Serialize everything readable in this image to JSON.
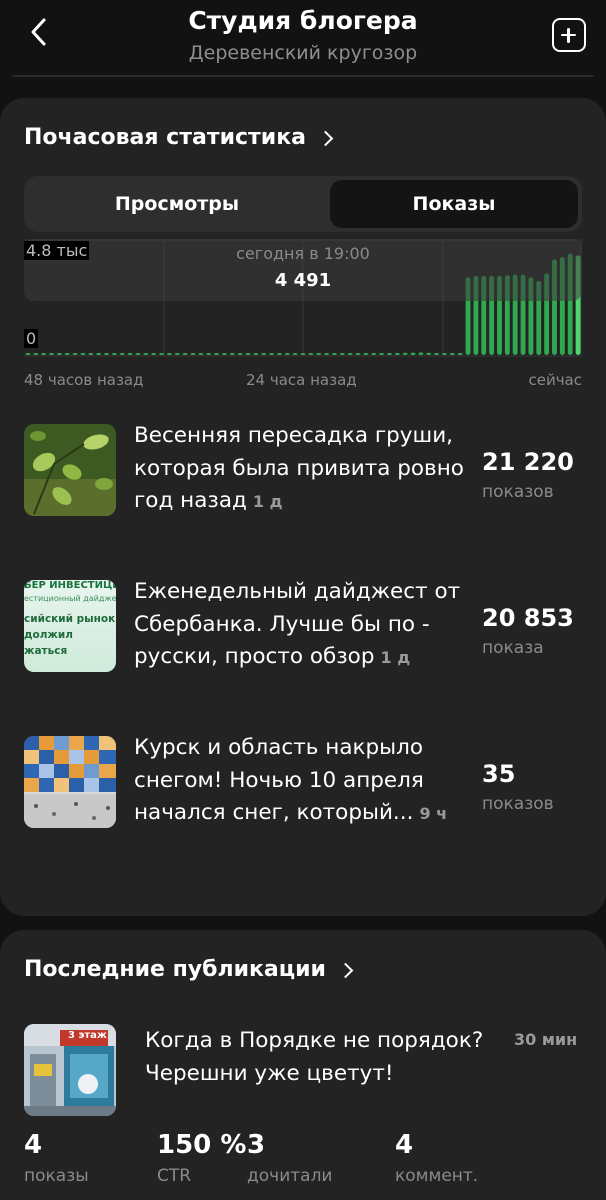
{
  "header": {
    "title": "Студия блогера",
    "subtitle": "Деревенский кругозор"
  },
  "hourly": {
    "title": "Почасовая статистика",
    "tabs": [
      "Просмотры",
      "Показы"
    ],
    "selected_tab": "Показы",
    "tooltip_label": "сегодня в 19:00",
    "tooltip_value": "4 491",
    "y_max_label": "4.8 тыс",
    "y_min_label": "0",
    "x_labels": [
      "48 часов назад",
      "24 часа назад",
      "сейчас"
    ]
  },
  "chart_data": {
    "type": "bar",
    "title": "",
    "xlabel": "",
    "ylabel": "",
    "ylim": [
      0,
      4800
    ],
    "accent": "#2fa84f",
    "highlight": "#4fd66f",
    "values": [
      35,
      35,
      35,
      35,
      35,
      35,
      35,
      35,
      35,
      35,
      35,
      35,
      35,
      35,
      35,
      35,
      35,
      35,
      35,
      35,
      35,
      35,
      35,
      35,
      35,
      35,
      35,
      35,
      35,
      35,
      35,
      35,
      35,
      35,
      35,
      35,
      35,
      35,
      35,
      35,
      35,
      35,
      35,
      35,
      40,
      45,
      60,
      70,
      95,
      100,
      110,
      95,
      75,
      70,
      60,
      40,
      3330,
      3390,
      3390,
      3390,
      3390,
      3420,
      3450,
      3450,
      3330,
      3170,
      3500,
      4100,
      4200,
      4350,
      4270
    ]
  },
  "top_items": [
    {
      "title": "Весенняя пересадка груши, которая была привита ровно год назад",
      "age": "1 д",
      "count": "21 220",
      "unit": "показов"
    },
    {
      "title": "Еженедельный дайджест от Сбербанка. Лучше бы по - русски, просто обзор",
      "age": "1 д",
      "count": "20 853",
      "unit": "показа",
      "thumb_lines": [
        "БЕР ИНВЕСТИЦИ",
        "естиционный дайдже",
        "сийский рынок",
        "должил",
        "жаться"
      ]
    },
    {
      "title": "Курск и область накрыло снегом! Ночью 10 апреля начался снег, который...",
      "age": "9 ч",
      "count": "35",
      "unit": "показов"
    }
  ],
  "latest": {
    "title": "Последние публикации",
    "post_title": "Когда в Порядке не порядок? Черешни уже цветут!",
    "age": "30 мин",
    "thumb_text": "3 этаж",
    "stats": [
      {
        "value": "4",
        "label": "показы"
      },
      {
        "value": "150 %",
        "label": "CTR"
      },
      {
        "value": "3",
        "label": "дочитали"
      },
      {
        "value": "4",
        "label": "коммент."
      }
    ]
  },
  "icons": {
    "back": "chevron-left-icon",
    "add": "add-square-icon",
    "section": "chevron-right-icon"
  }
}
